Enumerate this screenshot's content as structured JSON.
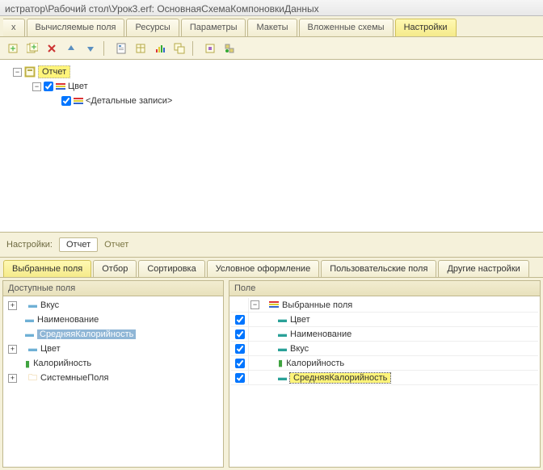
{
  "title": "истратор\\Рабочий стол\\Урок3.erf: ОсновнаяСхемаКомпоновкиДанных",
  "mainTabs": {
    "cut": "х",
    "t1": "Вычисляемые поля",
    "t2": "Ресурсы",
    "t3": "Параметры",
    "t4": "Макеты",
    "t5": "Вложенные схемы",
    "t6": "Настройки"
  },
  "tree": {
    "root": "Отчет",
    "node1": "Цвет",
    "node2": "<Детальные записи>"
  },
  "settingsBar": {
    "label": "Настройки:",
    "tab": "Отчет",
    "link": "Отчет"
  },
  "subTabs": {
    "t1": "Выбранные поля",
    "t2": "Отбор",
    "t3": "Сортировка",
    "t4": "Условное оформление",
    "t5": "Пользовательские поля",
    "t6": "Другие настройки"
  },
  "leftPanel": {
    "header": "Доступные поля",
    "items": [
      "Вкус",
      "Наименование",
      "СредняяКалорийность",
      "Цвет",
      "Калорийность",
      "СистемныеПоля"
    ]
  },
  "rightPanel": {
    "header": "Поле",
    "root": "Выбранные поля",
    "items": [
      "Цвет",
      "Наименование",
      "Вкус",
      "Калорийность",
      "СредняяКалорийность"
    ]
  }
}
